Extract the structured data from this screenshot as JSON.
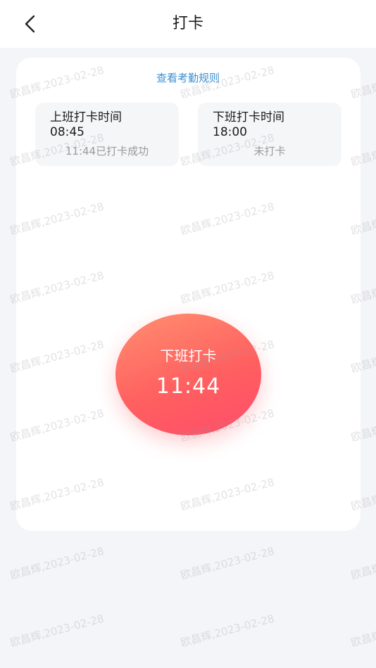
{
  "header": {
    "title": "打卡",
    "back_icon": "chevron-left-icon"
  },
  "card": {
    "rules_link": "查看考勤规则",
    "clock_in": {
      "title": "上班打卡时间",
      "time": "08:45",
      "status": "11:44已打卡成功"
    },
    "clock_out": {
      "title": "下班打卡时间",
      "time": "18:00",
      "status": "未打卡"
    },
    "punch_button": {
      "label": "下班打卡",
      "time": "11:44"
    }
  },
  "watermark": "欧昌辉,2023-02-28",
  "colors": {
    "link": "#3b8fd0",
    "button_gradient_start": "#ff8f70",
    "button_gradient_end": "#ff4d6a",
    "background": "#f4f5f9"
  }
}
